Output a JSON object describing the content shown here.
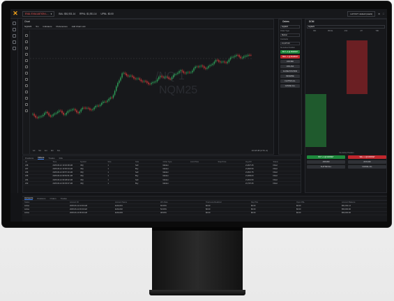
{
  "topbar": {
    "account": "EVAL EVALUATION L...",
    "balance": "BAL: $51,931.14",
    "rpnl": "RPNL: $1,931.14",
    "upnl": "UPNL: $0.00",
    "layout": "LAYOUT: default (stack)"
  },
  "chart": {
    "panel_label": "Chart",
    "symbol": "NQM25",
    "timeframe": "5m",
    "toolbar": [
      "Indicators",
      "Preferences",
      "Add Chart Link"
    ],
    "watermark": "/NQ 1\nNQM25",
    "footer_ranges": [
      "1d",
      "5d",
      "1m",
      "3m",
      "6m"
    ],
    "footer_time": "10:18:38 (UTC-4)",
    "footer_opts": [
      "ETH",
      "%",
      "log",
      "auto"
    ]
  },
  "orders_panel": {
    "title": "Orders",
    "symbol": "NQM25",
    "type_label": "Order Type",
    "type_value": "Market",
    "contracts_label": "Contracts",
    "price_value": "21,437.00",
    "no_position": "No Active Position",
    "buttons": [
      "BUY +1 @ MARKET",
      "SELL -1 @ MARKET",
      "JOIN BID",
      "JOIN ASK",
      "CLOSE POSITION",
      "REVERSE",
      "FLATTEN ALL",
      "CANCEL ALL"
    ]
  },
  "dom": {
    "title": "DOM",
    "symbol": "NQM25",
    "columns": [
      "BID",
      "PRICE",
      "ASK",
      "MY",
      "TRD"
    ],
    "no_position": "No Active Position",
    "buttons": [
      "BUY +1 @ MARKET",
      "SELL -1 @ MARKET",
      "JOIN BID",
      "JOIN ASK",
      "FLATTEN ALL",
      "CANCEL ALL"
    ]
  },
  "orders_table": {
    "tabs": [
      "Positions",
      "Orders",
      "Trades",
      "Fills"
    ],
    "active_tab": "Orders",
    "headers": [
      "ID",
      "Time",
      "Symbol",
      "Size",
      "Side",
      "Order Type",
      "Limit Price",
      "Stop Price",
      "Avg Fill",
      "Status"
    ],
    "rows": [
      [
        "238",
        "2025-06-12 10:02:28 AM",
        "/NQ",
        "1",
        "Sell",
        "Market",
        "",
        "",
        "21,827.25",
        "Filled"
      ],
      [
        "237",
        "2025-06-12 10:00:34 AM",
        "/NQ",
        "1",
        "Buy",
        "Market",
        "",
        "",
        "21,820.50",
        "Filled"
      ],
      [
        "236",
        "2025-06-12 09:57:10 AM",
        "/NQ",
        "1",
        "Sell",
        "Market",
        "",
        "",
        "21,816.75",
        "Filled"
      ],
      [
        "235",
        "2025-06-12 09:52:51 AM",
        "/NQ",
        "1",
        "Buy",
        "Market",
        "",
        "",
        "21,809.00",
        "Filled"
      ],
      [
        "234",
        "2025-06-12 09:48:02 AM",
        "/NQ",
        "1",
        "Sell",
        "Market",
        "",
        "",
        "21,801.50",
        "Filled"
      ],
      [
        "233",
        "2025-06-12 09:45:37 AM",
        "/NQ",
        "1",
        "Buy",
        "Market",
        "",
        "",
        "21,797.25",
        "Filled"
      ]
    ]
  },
  "accounts": {
    "tabs": [
      "Accounts",
      "Positions",
      "Orders",
      "Trades"
    ],
    "headers": [
      "Status",
      "Account ID",
      "Account Name",
      "Win Rate",
      "Total Loss Realized",
      "Day P&L",
      "Open P&L",
      "Account Balance"
    ],
    "rows": [
      [
        "Active",
        "2025-06-12 10:00 AM",
        "EVAL001",
        "66.00%",
        "$0.00",
        "$0.00",
        "$0.00",
        "$51,931.14"
      ],
      [
        "Active",
        "2025-06-11 09:30 AM",
        "EVAL002",
        "52.00%",
        "$0.00",
        "$0.00",
        "$0.00",
        "$50,000.00"
      ],
      [
        "Active",
        "2025-06-10 09:30 AM",
        "EVAL003",
        "48.00%",
        "$0.00",
        "$0.00",
        "$0.00",
        "$50,000.00"
      ]
    ]
  },
  "colors": {
    "accent": "#f3a21a",
    "buy": "#1e8a3c",
    "sell": "#c0272d",
    "bg": "#131417"
  }
}
